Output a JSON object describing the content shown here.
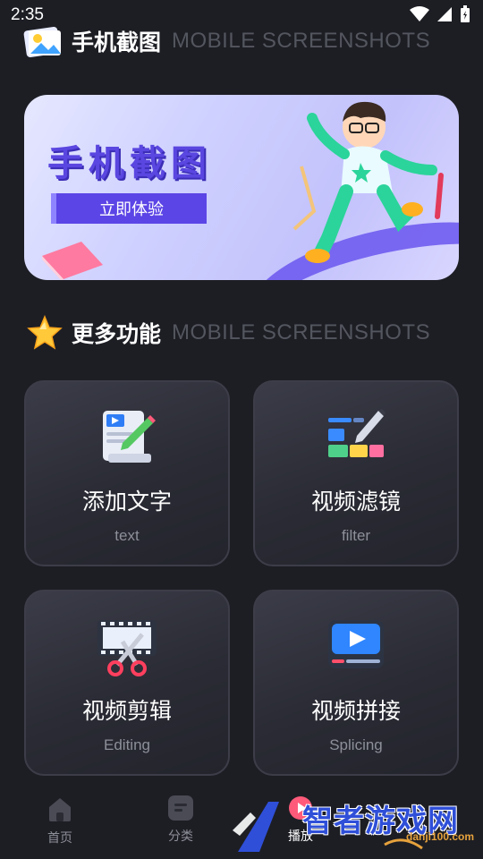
{
  "status_bar": {
    "time": "2:35"
  },
  "header": {
    "title": "手机截图",
    "subtitle": "MOBILE SCREENSHOTS"
  },
  "banner": {
    "title": "手机截图",
    "button": "立即体验"
  },
  "section": {
    "title": "更多功能",
    "subtitle": "MOBILE SCREENSHOTS"
  },
  "cards": [
    {
      "title": "添加文字",
      "subtitle": "text",
      "icon": "edit-document-icon"
    },
    {
      "title": "视频滤镜",
      "subtitle": "filter",
      "icon": "color-filter-icon"
    },
    {
      "title": "视频剪辑",
      "subtitle": "Editing",
      "icon": "film-scissors-icon"
    },
    {
      "title": "视频拼接",
      "subtitle": "Splicing",
      "icon": "video-play-icon"
    }
  ],
  "nav": {
    "items": [
      {
        "label": "首页",
        "icon": "home-icon"
      },
      {
        "label": "分类",
        "icon": "category-icon"
      },
      {
        "label": "播放",
        "icon": "play-icon"
      }
    ]
  },
  "watermark": {
    "text": "智者游戏网",
    "url": "danji100.com"
  }
}
